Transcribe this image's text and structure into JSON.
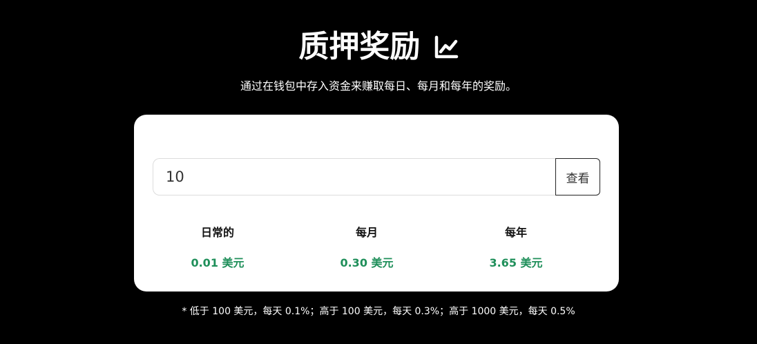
{
  "header": {
    "title": "质押奖励",
    "title_icon": "chart-line-icon",
    "subtitle": "通过在钱包中存入资金来赚取每日、每月和每年的奖励。"
  },
  "calculator": {
    "amount_value": "10",
    "view_button_label": "查看"
  },
  "rewards": [
    {
      "label": "日常的",
      "value": "0.01 美元"
    },
    {
      "label": "每月",
      "value": "0.30 美元"
    },
    {
      "label": "每年",
      "value": "3.65 美元"
    }
  ],
  "footnote": "* 低于 100 美元，每天 0.1%；高于 100 美元，每天 0.3%；高于 1000 美元，每天 0.5%",
  "colors": {
    "background": "#000000",
    "card": "#ffffff",
    "reward_value": "#1f8f5a"
  }
}
